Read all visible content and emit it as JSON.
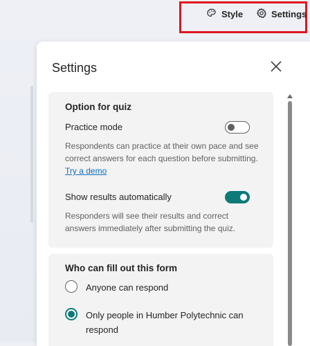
{
  "toolbar": {
    "style_label": "Style",
    "settings_label": "Settings",
    "style_icon": "palette-icon",
    "settings_icon": "gear-icon",
    "highlight_color": "#e0141e"
  },
  "panel": {
    "title": "Settings",
    "close_icon": "close-icon"
  },
  "quiz_section": {
    "title": "Option for quiz",
    "practice_mode": {
      "label": "Practice mode",
      "enabled": false,
      "description": "Respondents can practice at their own pace and see correct answers for each question before submitting.",
      "link": "Try a demo"
    },
    "show_results": {
      "label": "Show results automatically",
      "enabled": true,
      "description": "Responders will see their results and correct answers immediately after submitting the quiz."
    }
  },
  "access_section": {
    "title": "Who can fill out this form",
    "options": [
      {
        "label": "Anyone can respond",
        "selected": false
      },
      {
        "label": "Only people in Humber Polytechnic can respond",
        "selected": true
      }
    ]
  },
  "colors": {
    "accent": "#0e7a78",
    "link": "#0f6cbd",
    "card_bg": "#f3f3f3"
  }
}
